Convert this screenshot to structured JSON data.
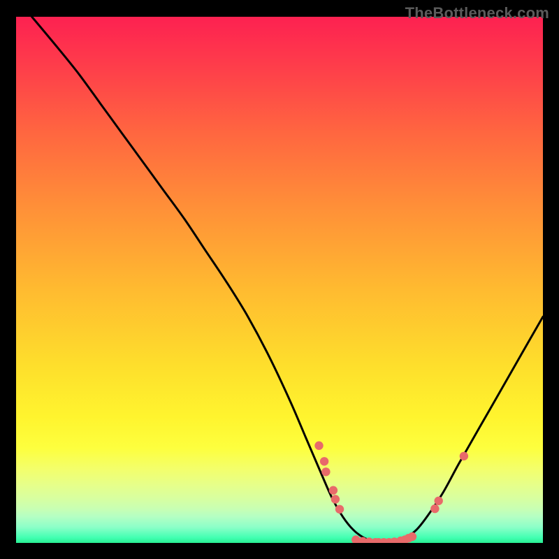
{
  "watermark": "TheBottleneck.com",
  "chart_data": {
    "type": "line",
    "title": "",
    "xlabel": "",
    "ylabel": "",
    "xlim": [
      0,
      100
    ],
    "ylim": [
      0,
      100
    ],
    "series": [
      {
        "name": "curve",
        "x": [
          3,
          8,
          12,
          16,
          20,
          24,
          28,
          32,
          36,
          40,
          44,
          48,
          52,
          55,
          58,
          60,
          62,
          64,
          66,
          68,
          70,
          72,
          74,
          76,
          78,
          81,
          84,
          88,
          92,
          96,
          100
        ],
        "y": [
          100,
          94,
          89,
          83.5,
          78,
          72.5,
          67,
          61.5,
          55.5,
          49.5,
          43,
          35.5,
          27,
          20,
          13,
          8.5,
          5,
          2.5,
          1,
          0.3,
          0.1,
          0.3,
          1,
          2.5,
          5,
          9.5,
          15,
          22,
          29,
          36,
          43
        ]
      }
    ],
    "markers": [
      {
        "x": 57.5,
        "y": 18.5
      },
      {
        "x": 58.5,
        "y": 15.5
      },
      {
        "x": 58.8,
        "y": 13.5
      },
      {
        "x": 60.2,
        "y": 10.0
      },
      {
        "x": 60.6,
        "y": 8.3
      },
      {
        "x": 61.4,
        "y": 6.4
      },
      {
        "x": 64.5,
        "y": 0.6
      },
      {
        "x": 65.8,
        "y": 0.3
      },
      {
        "x": 67.0,
        "y": 0.2
      },
      {
        "x": 68.2,
        "y": 0.1
      },
      {
        "x": 68.8,
        "y": 0.1
      },
      {
        "x": 69.8,
        "y": 0.1
      },
      {
        "x": 70.8,
        "y": 0.1
      },
      {
        "x": 71.8,
        "y": 0.2
      },
      {
        "x": 73.0,
        "y": 0.4
      },
      {
        "x": 73.8,
        "y": 0.6
      },
      {
        "x": 74.5,
        "y": 0.9
      },
      {
        "x": 75.2,
        "y": 1.2
      },
      {
        "x": 79.5,
        "y": 6.5
      },
      {
        "x": 80.2,
        "y": 8.0
      },
      {
        "x": 85.0,
        "y": 16.5
      }
    ],
    "gradient_stops": [
      {
        "pos": 0,
        "color": "#fd2151"
      },
      {
        "pos": 0.5,
        "color": "#ffd22e"
      },
      {
        "pos": 0.82,
        "color": "#fdff3e"
      },
      {
        "pos": 1.0,
        "color": "#28ef92"
      }
    ]
  }
}
